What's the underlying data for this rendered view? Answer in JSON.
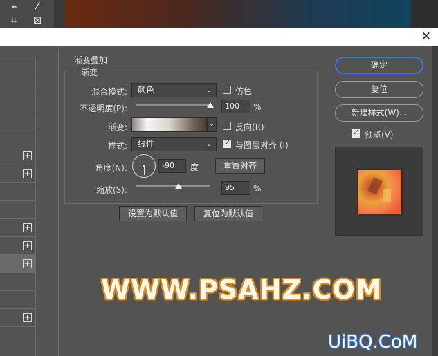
{
  "toolbar": {
    "tools": [
      "lasso-icon",
      "magic-wand-icon",
      "crop-icon",
      "frame-icon"
    ]
  },
  "dialog": {
    "close_glyph": "✕",
    "left_list_plus": "+",
    "group_title": "渐变叠加",
    "sub_title": "渐变",
    "blend_mode": {
      "label": "混合模式:",
      "value": "颜色"
    },
    "dither": {
      "label": "仿色",
      "checked": false
    },
    "opacity": {
      "label": "不透明度(P):",
      "value": "100",
      "unit": "%",
      "level": 1.0
    },
    "gradient": {
      "label": "渐变:"
    },
    "reverse": {
      "label": "反向(R)",
      "checked": false
    },
    "style": {
      "label": "样式:",
      "value": "线性"
    },
    "align_layer": {
      "label": "与图层对齐 (I)",
      "checked": true
    },
    "angle": {
      "label": "角度(N):",
      "value": "-90",
      "unit": "度"
    },
    "reset_align": "重置对齐",
    "scale": {
      "label": "缩放(S):",
      "value": "95",
      "unit": "%",
      "level": 0.95
    },
    "set_default": "设置为默认值",
    "reset_default": "复位为默认值",
    "ok": "确定",
    "reset": "复位",
    "new_style": "新建样式(W)...",
    "preview": {
      "label": "预览(V)",
      "checked": true
    }
  },
  "watermarks": {
    "main": "WWW.PSAHZ.COM",
    "corner": "UiBQ.CoM"
  },
  "colors": {
    "dialog_bg": "#535353",
    "primary_border": "#3f78d8",
    "watermark_outline": "#d58a20"
  }
}
